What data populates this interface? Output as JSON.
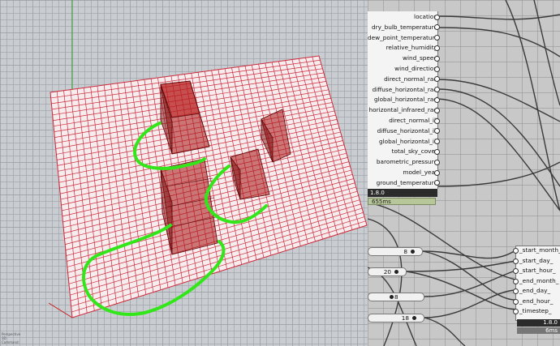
{
  "viewport": {
    "label": "rhino-3d-viewport",
    "status_lines": [
      "Perspective",
      "3D",
      "Command:"
    ]
  },
  "outputs": [
    "location",
    "dry_bulb_temperature",
    "dew_point_temperature",
    "relative_humidity",
    "wind_speed",
    "wind_direction",
    "direct_normal_rad",
    "diffuse_horizontal_rad",
    "global_horizontal_rad",
    "horizontal_infrared_rad",
    "direct_normal_ill",
    "diffuse_horizontal_ill",
    "global_horizontal_ill",
    "total_sky_cover",
    "barometric_pressure",
    "model_year",
    "ground_temperature"
  ],
  "component_version": "1.8.0",
  "component_time": "655ms",
  "sliders": [
    {
      "value": "8"
    },
    {
      "value": "20"
    },
    {
      "value": "8"
    },
    {
      "value": "18"
    }
  ],
  "analysis_node": {
    "inputs": [
      "_start_month_",
      "_start_day_",
      "_start_hour_",
      "_end_month_",
      "_end_day_",
      "_end_hour_",
      "_timestep_"
    ],
    "version": "1.8.0",
    "time": "6ms"
  },
  "colors": {
    "grid_line": "#cc2a3a",
    "box_fill": "#b01818",
    "sketch_green": "#33e61a"
  }
}
